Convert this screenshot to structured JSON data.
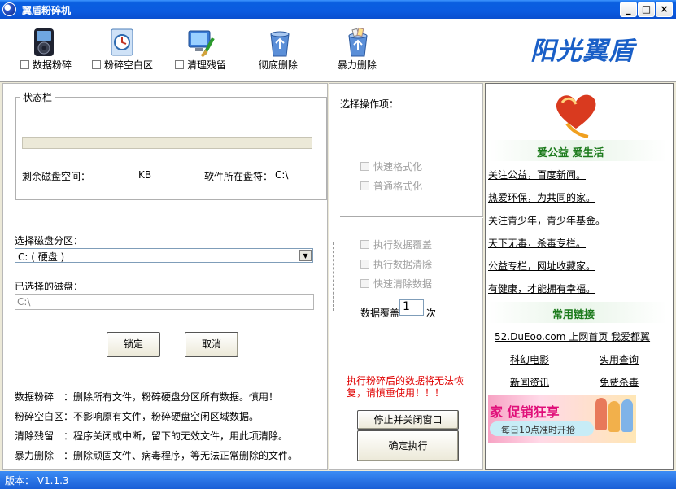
{
  "window": {
    "title": "翼盾粉碎机",
    "minimize": "_",
    "maximize": "□",
    "close": "×"
  },
  "toolbar": {
    "items": [
      {
        "label": "数据粉碎",
        "icon": "mp3-player-icon",
        "checkbox": true
      },
      {
        "label": "粉碎空白区",
        "icon": "clock-file-icon",
        "checkbox": true
      },
      {
        "label": "清理残留",
        "icon": "monitor-clean-icon",
        "checkbox": true
      },
      {
        "label": "彻底删除",
        "icon": "recycle-bin-icon",
        "checkbox": false
      },
      {
        "label": "暴力删除",
        "icon": "recycle-bin-full-icon",
        "checkbox": false
      }
    ],
    "brand": "阳光翼盾"
  },
  "left": {
    "status_title": "状态栏",
    "free_space_label": "剩余磁盘空间：",
    "free_space_unit": "KB",
    "software_drive_label": "软件所在盘符：",
    "software_drive_value": "C:\\",
    "partition_label": "选择磁盘分区：",
    "partition_value": "C: ( 硬盘 )",
    "selected_disk_label": "已选择的磁盘：",
    "selected_disk_value": "C:\\",
    "lock_button": "锁定",
    "cancel_button": "取消",
    "help": [
      {
        "term": "数据粉碎",
        "desc": "：删除所有文件，粉碎硬盘分区所有数据。慎用！"
      },
      {
        "term": "粉碎空白区",
        "desc": "：不影响原有文件，粉碎硬盘空闲区域数据。"
      },
      {
        "term": "清除残留",
        "desc": "：程序关闭或中断，留下的无效文件，用此项清除。"
      },
      {
        "term": "暴力删除",
        "desc": "：删除顽固文件、病毒程序，等无法正常删除的文件。"
      }
    ]
  },
  "middle": {
    "options_title": "选择操作项：",
    "quick_format": "快速格式化",
    "normal_format": "普通格式化",
    "overwrite": "执行数据覆盖",
    "clear": "执行数据清除",
    "quick_clear": "快速清除数据",
    "overwrite_count_label": "数据覆盖",
    "overwrite_count_value": "1",
    "overwrite_count_unit": "次",
    "warning": "执行粉碎后的数据将无法恢复，请慎重使用！！！",
    "stop_button": "停止并关闭窗口",
    "confirm_button": "确定执行"
  },
  "right": {
    "slogan": "爱公益 爱生活",
    "links": [
      "关注公益，百度新闻。",
      "热爱环保，为共同的家。",
      "关注青少年，青少年基金。",
      "天下无毒，杀毒专栏。",
      "公益专栏，网址收藏家。",
      "有健康，才能拥有幸福。"
    ],
    "common_links_title": "常用链接",
    "site_link": "52.DuEoo.com 上网首页 我爱都翼",
    "grid_links": [
      "科幻电影",
      "实用查询",
      "新闻资讯",
      "免费杀毒"
    ],
    "ad": {
      "headline": "家 促销狂享",
      "sub": "每日10点准时开抢"
    }
  },
  "statusbar": {
    "version": "版本： V1.1.3"
  },
  "colors": {
    "brand": "#1a5fc7",
    "warning": "#e00000",
    "green_heading": "#1b7a1b"
  }
}
